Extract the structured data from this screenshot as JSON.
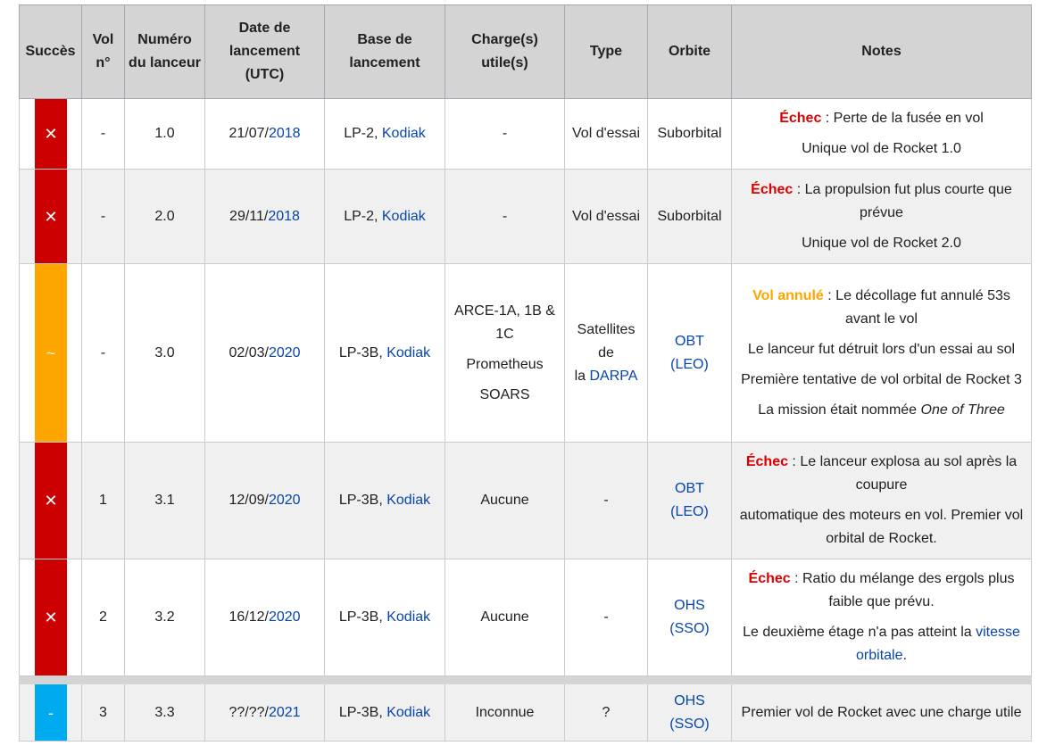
{
  "headers": {
    "succes": "Succès",
    "vol": "Vol n°",
    "numero": "Numéro du lanceur",
    "date": "Date de lancement (UTC)",
    "base": "Base de lancement",
    "charge": "Charge(s) utile(s)",
    "type": "Type",
    "orbite": "Orbite",
    "notes": "Notes"
  },
  "rows": [
    {
      "status_symbol": "✕",
      "vol": "-",
      "numero": "1.0",
      "date_prefix": "21/07/",
      "date_year": "2018",
      "base_prefix": "LP-2, ",
      "base_link": "Kodiak",
      "charge": "-",
      "type": "Vol d'essai",
      "orbite": "Suborbital",
      "note1_label": "Échec",
      "note1_text": " : Perte de la fusée en vol",
      "note2_text": "Unique vol de Rocket 1.0"
    },
    {
      "status_symbol": "✕",
      "vol": "-",
      "numero": "2.0",
      "date_prefix": "29/11/",
      "date_year": "2018",
      "base_prefix": "LP-2, ",
      "base_link": "Kodiak",
      "charge": "-",
      "type": "Vol d'essai",
      "orbite": "Suborbital",
      "note1_label": "Échec",
      "note1_text": " : La propulsion fut plus courte que prévue",
      "note2_text": "Unique vol de Rocket 2.0"
    },
    {
      "status_symbol": "~",
      "vol": "-",
      "numero": "3.0",
      "date_prefix": "02/03/",
      "date_year": "2020",
      "base_prefix": "LP-3B, ",
      "base_link": "Kodiak",
      "charge_lines": [
        "ARCE-1A, 1B & 1C",
        "Prometheus",
        "SOARS"
      ],
      "type_line1": "Satellites de",
      "type_line2_prefix": "la ",
      "type_link": "DARPA",
      "orbite_link1": "OBT",
      "orbite_link2": "(LEO)",
      "note1_label": "Vol annulé",
      "note1_text": " : Le décollage fut annulé 53s avant le vol",
      "note2_text": "Le lanceur fut détruit lors d'un essai au sol",
      "note3_text": "Première tentative de vol orbital de Rocket 3",
      "note4_prefix": "La mission était nommée ",
      "note4_italic": "One of Three"
    },
    {
      "status_symbol": "✕",
      "vol": "1",
      "numero": "3.1",
      "date_prefix": "12/09/",
      "date_year": "2020",
      "base_prefix": "LP-3B, ",
      "base_link": "Kodiak",
      "charge": "Aucune",
      "type": "-",
      "orbite_link1": "OBT",
      "orbite_link2": "(LEO)",
      "note1_label": "Échec",
      "note1_text": " : Le lanceur explosa au sol après la coupure",
      "note2_text": "automatique des moteurs en vol. Premier vol orbital de Rocket."
    },
    {
      "status_symbol": "✕",
      "vol": "2",
      "numero": "3.2",
      "date_prefix": "16/12/",
      "date_year": "2020",
      "base_prefix": "LP-3B, ",
      "base_link": "Kodiak",
      "charge": "Aucune",
      "type": "-",
      "orbite_link1": "OHS",
      "orbite_link2": "(SSO)",
      "note1_label": "Échec",
      "note1_text": " : Ratio du mélange des ergols plus faible que prévu.",
      "note2_text": "Le deuxième étage n'a pas atteint la ",
      "note2_link": "vitesse orbitale",
      "note2_suffix": "."
    },
    {
      "status_symbol": "-",
      "vol": "3",
      "numero": "3.3",
      "date_prefix": "??/??/",
      "date_year": "2021",
      "base_prefix": "LP-3B, ",
      "base_link": "Kodiak",
      "charge": "Inconnue",
      "type": "?",
      "orbite_link1": "OHS",
      "orbite_link2": "(SSO)",
      "note1_text": "Premier vol de Rocket avec une charge utile"
    }
  ],
  "colors": {
    "fail": "#cc0000",
    "cancelled": "#ffa500",
    "planned": "#00aaee",
    "link": "#0645ad",
    "header_bg": "#d4d4d4"
  }
}
